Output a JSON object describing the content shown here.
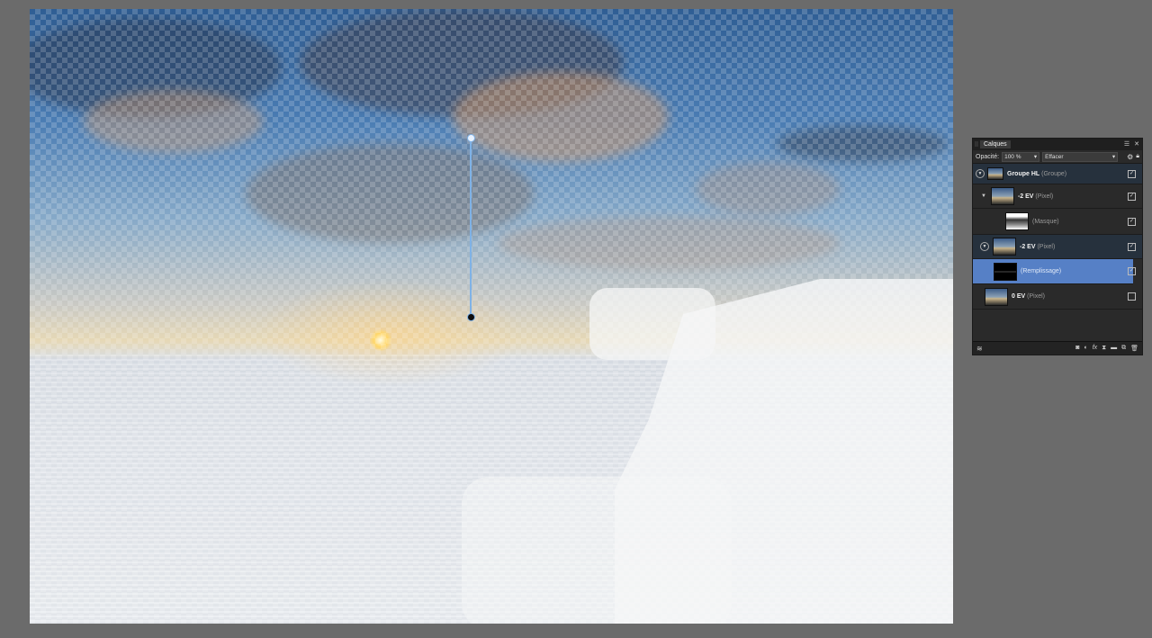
{
  "layers_panel": {
    "tab_label": "Calques",
    "opacity_label": "Opacité:",
    "opacity_value": "100 %",
    "blend_mode": "Effacer",
    "layers": [
      {
        "name": "Groupe HL",
        "type": "(Groupe)",
        "visible": true
      },
      {
        "name": "-2 EV",
        "type": "(Pixel)",
        "visible": true
      },
      {
        "name": "",
        "type": "(Masque)",
        "visible": true
      },
      {
        "name": "-2 EV",
        "type": "(Pixel)",
        "visible": true
      },
      {
        "name": "",
        "type": "(Remplissage)",
        "visible": true,
        "selected": true
      },
      {
        "name": "0 EV",
        "type": "(Pixel)",
        "visible": false
      }
    ]
  },
  "icons": {
    "panel_menu": "menu-icon",
    "panel_close": "close-icon",
    "settings": "gear-icon",
    "lock": "lock-icon",
    "footer": [
      "mask-icon",
      "adjustment-icon",
      "fx-icon",
      "live-filter-icon",
      "group-icon",
      "duplicate-icon",
      "trash-icon"
    ]
  },
  "colors": {
    "workspace": "#6b6b6b",
    "panel_bg": "#2a2a2a",
    "selection": "#5680c6",
    "gradient_handle": "#7fb2e6"
  }
}
